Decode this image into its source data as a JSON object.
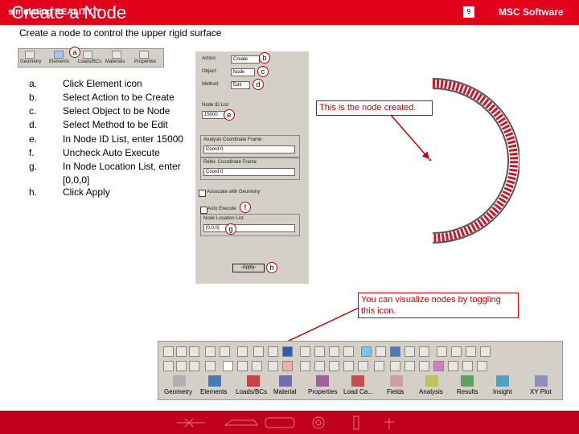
{
  "title": "Create a Node",
  "subtitle": "Create a node to control the upper rigid surface",
  "steps": [
    {
      "letter": "a.",
      "text": "Click Element icon"
    },
    {
      "letter": "b.",
      "text": "Select Action to be Create"
    },
    {
      "letter": "c.",
      "text": "Select Object to be Node"
    },
    {
      "letter": "d.",
      "text": "Select Method to be Edit"
    },
    {
      "letter": "e.",
      "text": "In Node ID List, enter 15000"
    },
    {
      "letter": "f.",
      "text": "Uncheck Auto Execute"
    },
    {
      "letter": "g.",
      "text": "In Node Location List, enter [0,0,0]"
    },
    {
      "letter": "h.",
      "text": "Click Apply"
    }
  ],
  "small_toolbar": {
    "labels": [
      "Geometry",
      "Elements",
      "Loads/BCs",
      "Materials",
      "Properties"
    ]
  },
  "form": {
    "action_label": "Action:",
    "action_value": "Create",
    "object_label": "Object:",
    "object_value": "Node",
    "method_label": "Method:",
    "method_value": "Edit",
    "node_id_label": "Node ID List",
    "node_id_value": "15000",
    "analysis_frame_label": "Analysis Coordinate Frame",
    "analysis_frame_value": "Coord 0",
    "refer_frame_label": "Refer. Coordinate Frame",
    "refer_frame_value": "Coord 0",
    "associate_label": "Associate with Geometry",
    "auto_execute_label": "Auto Execute",
    "location_label": "Node Location List",
    "location_value": "[0,0,0]",
    "apply_label": "-Apply-"
  },
  "badges": {
    "a": "a",
    "b": "b",
    "c": "c",
    "d": "d",
    "e": "e",
    "f": "f",
    "g": "g",
    "h": "h"
  },
  "callout_node": "This is the node created.",
  "callout_visualize": "You can visualize nodes by toggling this icon.",
  "bottom_toolbar": {
    "labels": [
      "Geometry",
      "Elements",
      "Loads/BCs",
      "Material",
      "Properties",
      "Load Ca...",
      "Fields",
      "Analysis",
      "Results",
      "Insight",
      "XY Plot"
    ]
  },
  "footer": {
    "left": "simulating REALITY™",
    "page": "9",
    "right": "MSC Software"
  },
  "colors": {
    "brand_red": "#e2001a",
    "panel_gray": "#d4d0c8",
    "callout_red": "#cc0000"
  }
}
